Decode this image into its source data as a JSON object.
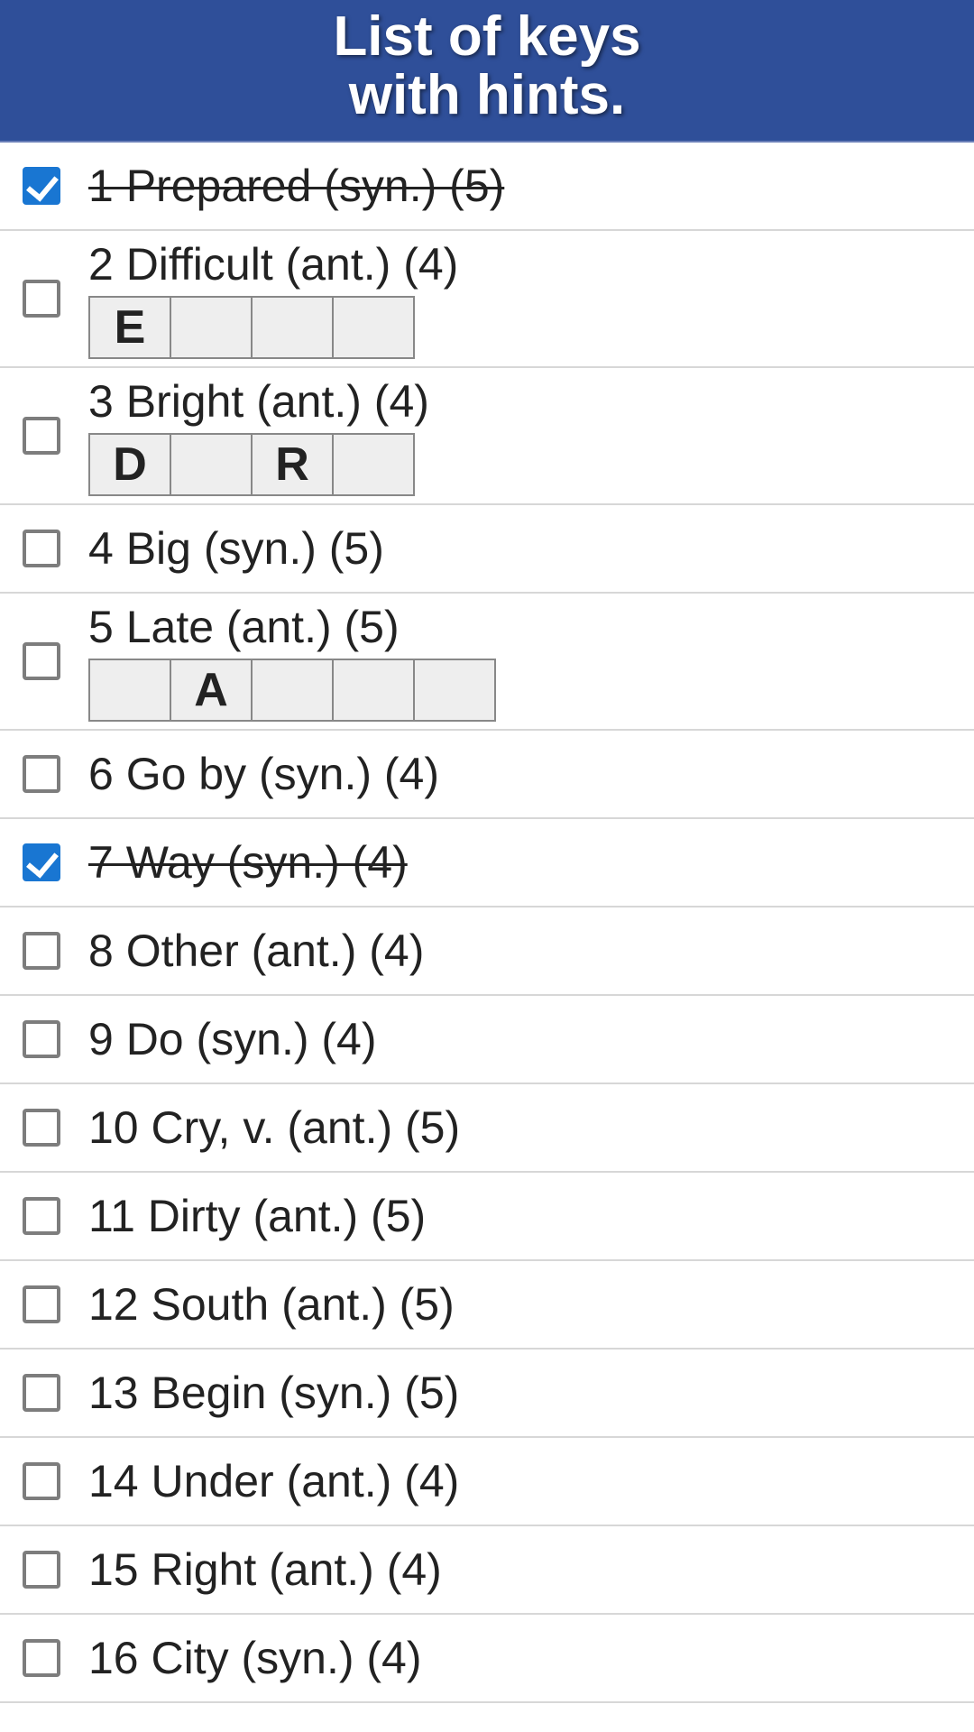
{
  "header": {
    "line1": "List of keys",
    "line2": "with hints."
  },
  "items": [
    {
      "num": 1,
      "clue": "1 Prepared (syn.) (5)",
      "checked": true,
      "hint": null
    },
    {
      "num": 2,
      "clue": "2 Difficult (ant.) (4)",
      "checked": false,
      "hint": [
        "E",
        "",
        "",
        ""
      ]
    },
    {
      "num": 3,
      "clue": "3 Bright (ant.) (4)",
      "checked": false,
      "hint": [
        "D",
        "",
        "R",
        ""
      ]
    },
    {
      "num": 4,
      "clue": "4 Big (syn.) (5)",
      "checked": false,
      "hint": null
    },
    {
      "num": 5,
      "clue": "5 Late (ant.) (5)",
      "checked": false,
      "hint": [
        "",
        "A",
        "",
        "",
        ""
      ]
    },
    {
      "num": 6,
      "clue": "6 Go by (syn.) (4)",
      "checked": false,
      "hint": null
    },
    {
      "num": 7,
      "clue": "7 Way (syn.) (4)",
      "checked": true,
      "hint": null
    },
    {
      "num": 8,
      "clue": "8 Other (ant.) (4)",
      "checked": false,
      "hint": null
    },
    {
      "num": 9,
      "clue": "9 Do (syn.) (4)",
      "checked": false,
      "hint": null
    },
    {
      "num": 10,
      "clue": "10 Cry, v. (ant.) (5)",
      "checked": false,
      "hint": null
    },
    {
      "num": 11,
      "clue": "11 Dirty (ant.) (5)",
      "checked": false,
      "hint": null
    },
    {
      "num": 12,
      "clue": "12 South (ant.) (5)",
      "checked": false,
      "hint": null
    },
    {
      "num": 13,
      "clue": "13 Begin (syn.) (5)",
      "checked": false,
      "hint": null
    },
    {
      "num": 14,
      "clue": "14 Under (ant.) (4)",
      "checked": false,
      "hint": null
    },
    {
      "num": 15,
      "clue": "15 Right (ant.) (4)",
      "checked": false,
      "hint": null
    },
    {
      "num": 16,
      "clue": "16 City (syn.) (4)",
      "checked": false,
      "hint": null
    }
  ]
}
